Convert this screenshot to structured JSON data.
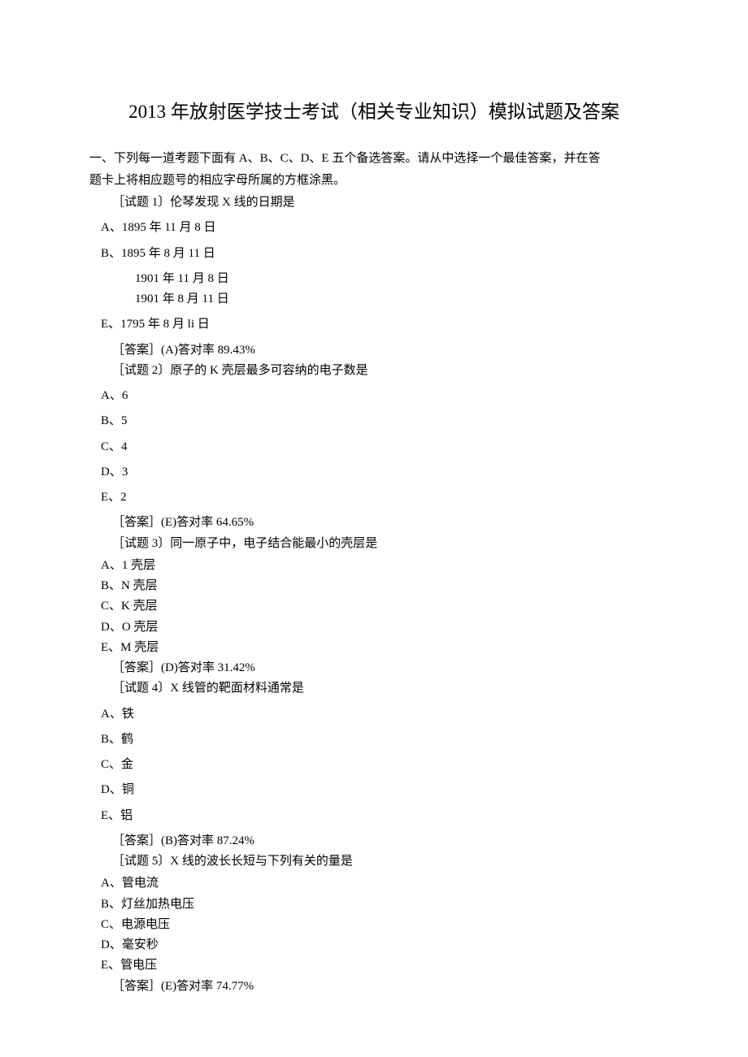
{
  "title": "2013 年放射医学技士考试（相关专业知识）模拟试题及答案",
  "instructions_l1": "一、下列每一道考题下面有 A、B、C、D、E 五个备选答案。请从中选择一个最佳答案，并在答",
  "instructions_l2": "题卡上将相应题号的相应字母所属的方框涂黑。",
  "q1": {
    "prompt": "［试题 1〕伦琴发现 X 线的日期是",
    "A": "A、1895 年 11 月 8 日",
    "B": "B、1895 年 8 月 11 日",
    "C": "1901 年 11 月 8 日",
    "D": "1901 年 8 月 11 日",
    "E": "E、1795 年 8 月 li 日",
    "answer": "［答案］(A)答对率 89.43%"
  },
  "q2": {
    "prompt": "［试题 2〕原子的 K 壳层最多可容纳的电子数是",
    "A": "A、6",
    "B": "B、5",
    "C": "C、4",
    "D": "D、3",
    "E": "E、2",
    "answer": "［答案］(E)答对率 64.65%"
  },
  "q3": {
    "prompt": "［试题 3〕同一原子中，电子结合能最小的壳层是",
    "A": "A、1 壳层",
    "B": "B、N 壳层",
    "C": "C、K 壳层",
    "D": "D、O 壳层",
    "E": "E、M 壳层",
    "answer": "［答案］(D)答对率 31.42%"
  },
  "q4": {
    "prompt": "［试题 4〕X 线管的靶面材料通常是",
    "A": "A、铁",
    "B": "B、鹤",
    "C": "C、金",
    "D": "D、铜",
    "E": "E、铝",
    "answer": "［答案］(B)答对率 87.24%"
  },
  "q5": {
    "prompt": "［试题 5〕X 线的波长长短与下列有关的量是",
    "A": "A、管电流",
    "B": "B、灯丝加热电压",
    "C": "C、电源电压",
    "D": "D、毫安秒",
    "E": "E、管电压",
    "answer": "［答案］(E)答对率 74.77%"
  }
}
